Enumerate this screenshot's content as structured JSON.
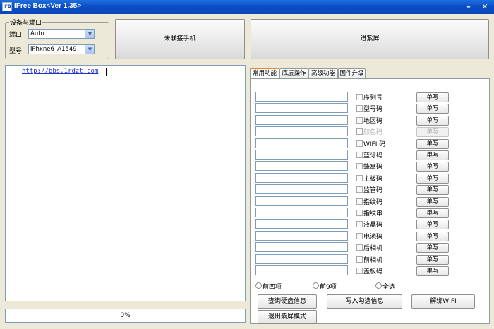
{
  "window": {
    "title": "IFree Box<Ver 1.35>",
    "app_icon": "IFB",
    "min_glyph": "–",
    "close_glyph": "✕"
  },
  "device_group": {
    "legend": "设备与端口",
    "port_label": "端口:",
    "port_value": "Auto",
    "model_label": "型号:",
    "model_value": "iPhxne6_A1549"
  },
  "buttons": {
    "phone_status": "未联接手机",
    "purple_screen": "进紫屏"
  },
  "log": {
    "link": "http://bbs.1rdzt.com"
  },
  "progress": {
    "text": "0%",
    "value": 0
  },
  "tabs": [
    {
      "label": "常用功能",
      "active": true
    },
    {
      "label": "底层操作",
      "active": false
    },
    {
      "label": "高级功能",
      "active": false
    },
    {
      "label": "固件升级",
      "active": false
    }
  ],
  "rows": [
    {
      "field": "",
      "label": "序列号",
      "enabled": true,
      "button": "单写"
    },
    {
      "field": "",
      "label": "型号码",
      "enabled": true,
      "button": "单写"
    },
    {
      "field": "",
      "label": "地区码",
      "enabled": true,
      "button": "单写"
    },
    {
      "field": "",
      "label": "颜色码",
      "enabled": false,
      "button": "单写"
    },
    {
      "field": "",
      "label": "WIFI 码",
      "enabled": true,
      "button": "单写"
    },
    {
      "field": "",
      "label": "蓝牙码",
      "enabled": true,
      "button": "单写"
    },
    {
      "field": "",
      "label": "蜂窝码",
      "enabled": true,
      "button": "单写"
    },
    {
      "field": "",
      "label": "主板码",
      "enabled": true,
      "button": "单写"
    },
    {
      "field": "",
      "label": "监管码",
      "enabled": true,
      "button": "单写"
    },
    {
      "field": "",
      "label": "指纹码",
      "enabled": true,
      "button": "单写"
    },
    {
      "field": "",
      "label": "指纹串",
      "enabled": true,
      "button": "单写"
    },
    {
      "field": "",
      "label": "液晶码",
      "enabled": true,
      "button": "单写"
    },
    {
      "field": "",
      "label": "电池码",
      "enabled": true,
      "button": "单写"
    },
    {
      "field": "",
      "label": "后相机",
      "enabled": true,
      "button": "单写"
    },
    {
      "field": "",
      "label": "前相机",
      "enabled": true,
      "button": "单写"
    },
    {
      "field": "",
      "label": "盖板码",
      "enabled": true,
      "button": "单写"
    }
  ],
  "radios": [
    {
      "label": "前四项"
    },
    {
      "label": "前9项"
    },
    {
      "label": "全选"
    }
  ],
  "actions": {
    "query_disk": "查询硬盘信息",
    "write_checked": "写入勾选信息",
    "unbind_wifi": "解绑WIFI",
    "exit_purple": "退出紫屏模式"
  }
}
